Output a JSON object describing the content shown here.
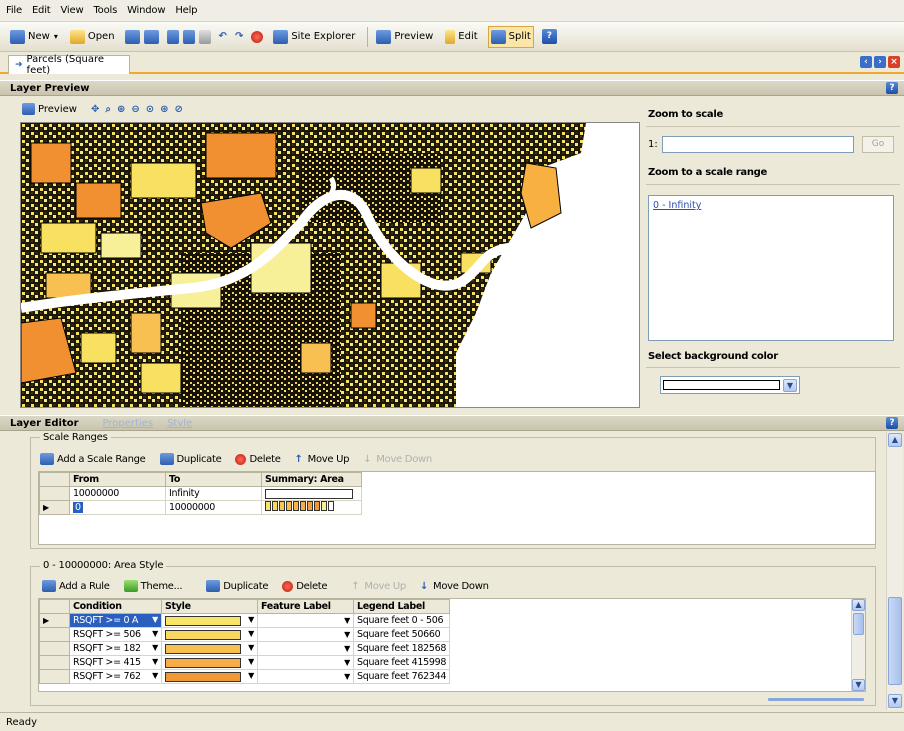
{
  "menu": [
    "File",
    "Edit",
    "View",
    "Tools",
    "Window",
    "Help"
  ],
  "toolbar": {
    "new": "New",
    "open": "Open",
    "site_explorer": "Site Explorer",
    "preview": "Preview",
    "edit": "Edit",
    "split": "Split"
  },
  "tab": {
    "label": "Parcels (Square feet)"
  },
  "layer_preview": {
    "title": "Layer Preview",
    "preview_button": "Preview"
  },
  "right_panel": {
    "zoom_to_scale": "Zoom to scale",
    "scale_prefix": "1:",
    "scale_value": "",
    "go": "Go",
    "zoom_range": "Zoom to a scale range",
    "range_link": "0 - Infinity",
    "bg_color": "Select background color"
  },
  "layer_editor": {
    "title": "Layer Editor",
    "tab_properties": "Properties",
    "tab_style": "Style",
    "scale_ranges": {
      "title": "Scale Ranges",
      "add": "Add a Scale Range",
      "duplicate": "Duplicate",
      "delete": "Delete",
      "move_up": "Move Up",
      "move_down": "Move Down",
      "columns": [
        "From",
        "To",
        "Summary: Area"
      ],
      "rows": [
        {
          "from": "10000000",
          "to": "Infinity"
        },
        {
          "from": "0",
          "to": "10000000"
        }
      ]
    },
    "area_style": {
      "title": "0 - 10000000: Area Style",
      "add_rule": "Add a Rule",
      "theme": "Theme...",
      "duplicate": "Duplicate",
      "delete": "Delete",
      "move_up": "Move Up",
      "move_down": "Move Down",
      "columns": [
        "Condition",
        "Style",
        "Feature Label",
        "Legend Label"
      ],
      "rows": [
        {
          "condition": "RSQFT >= 0 A",
          "color": "#f8e468",
          "legend": "Square feet 0 - 506"
        },
        {
          "condition": "RSQFT >= 506",
          "color": "#f8d860",
          "legend": "Square feet 50660"
        },
        {
          "condition": "RSQFT >= 182",
          "color": "#f8c050",
          "legend": "Square feet 182568"
        },
        {
          "condition": "RSQFT >= 415",
          "color": "#f8ac48",
          "legend": "Square feet 415998"
        },
        {
          "condition": "RSQFT >= 762",
          "color": "#f09838",
          "legend": "Square feet 762344"
        }
      ]
    }
  },
  "status": "Ready",
  "colors": {
    "accent": "#f0a830",
    "map_yellow": "#f8e060",
    "map_orange": "#f09030",
    "map_light": "#f8f098",
    "selection": "#2a5fc0"
  }
}
